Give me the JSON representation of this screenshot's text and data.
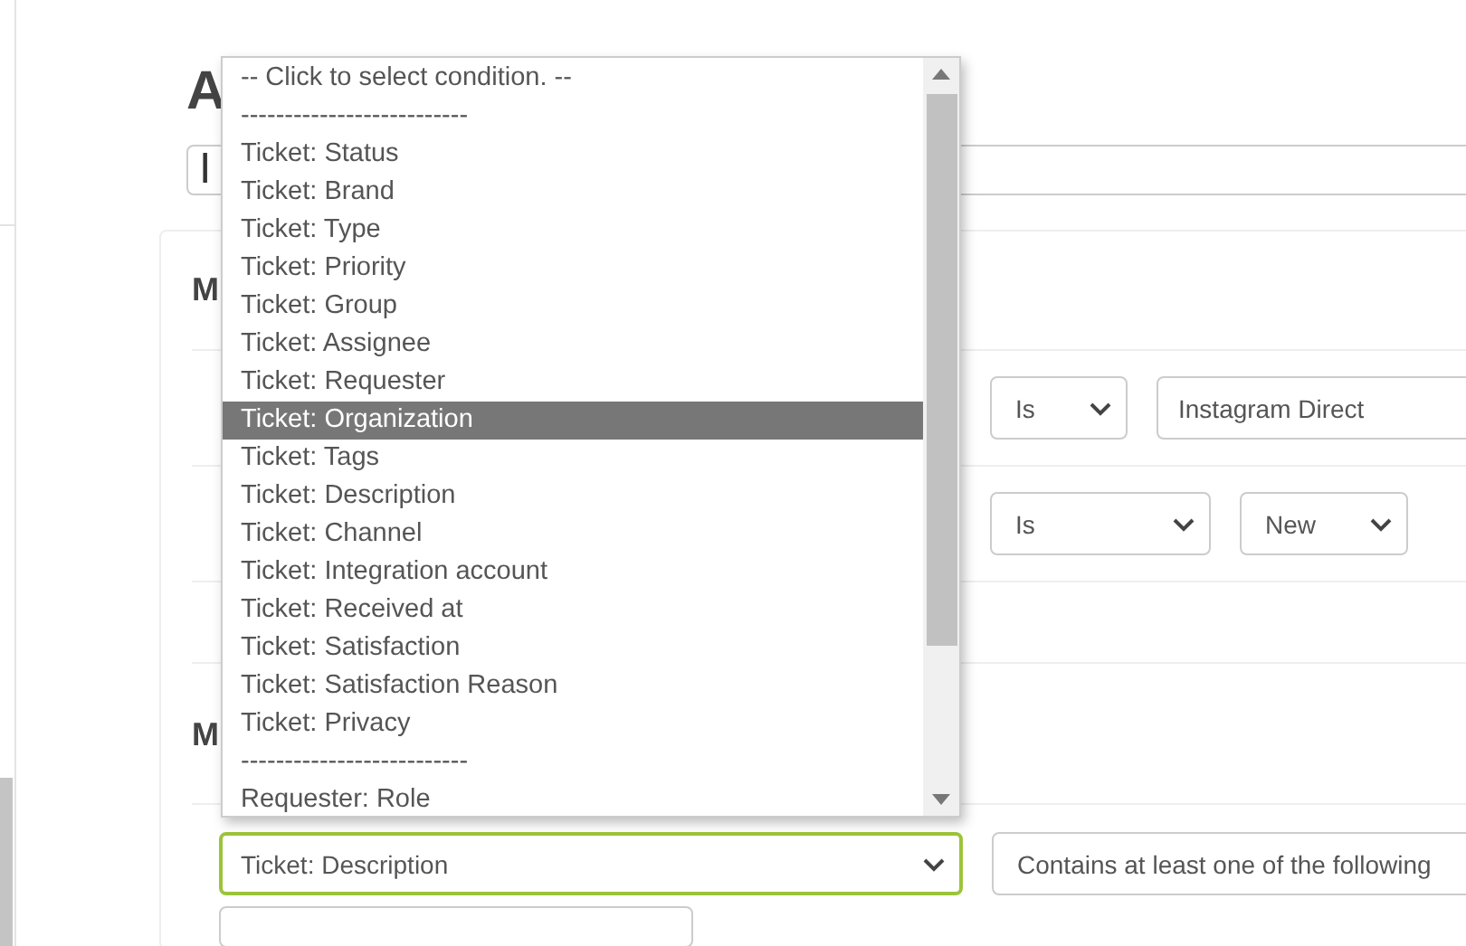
{
  "page": {
    "heading": "A",
    "name_field": {
      "value": "I"
    }
  },
  "sections": [
    {
      "title": "M",
      "rows": [
        {
          "operator": "Is",
          "value": {
            "kind": "field",
            "text": "Instagram Direct"
          }
        },
        {
          "operator": "Is",
          "value": {
            "kind": "select",
            "text": "New"
          }
        }
      ]
    },
    {
      "title": "M",
      "condition": {
        "field": "Ticket: Description",
        "operator": "Contains at least one of the following"
      }
    }
  ],
  "dropdown": {
    "options": [
      {
        "kind": "option",
        "label": "-- Click to select condition. --",
        "selected": false
      },
      {
        "kind": "separator",
        "label": "--------------------------"
      },
      {
        "kind": "option",
        "label": "Ticket: Status",
        "selected": false
      },
      {
        "kind": "option",
        "label": "Ticket: Brand",
        "selected": false
      },
      {
        "kind": "option",
        "label": "Ticket: Type",
        "selected": false
      },
      {
        "kind": "option",
        "label": "Ticket: Priority",
        "selected": false
      },
      {
        "kind": "option",
        "label": "Ticket: Group",
        "selected": false
      },
      {
        "kind": "option",
        "label": "Ticket: Assignee",
        "selected": false
      },
      {
        "kind": "option",
        "label": "Ticket: Requester",
        "selected": false
      },
      {
        "kind": "option",
        "label": "Ticket: Organization",
        "selected": true
      },
      {
        "kind": "option",
        "label": "Ticket: Tags",
        "selected": false
      },
      {
        "kind": "option",
        "label": "Ticket: Description",
        "selected": false
      },
      {
        "kind": "option",
        "label": "Ticket: Channel",
        "selected": false
      },
      {
        "kind": "option",
        "label": "Ticket: Integration account",
        "selected": false
      },
      {
        "kind": "option",
        "label": "Ticket: Received at",
        "selected": false
      },
      {
        "kind": "option",
        "label": "Ticket: Satisfaction",
        "selected": false
      },
      {
        "kind": "option",
        "label": "Ticket: Satisfaction Reason",
        "selected": false
      },
      {
        "kind": "option",
        "label": "Ticket: Privacy",
        "selected": false
      },
      {
        "kind": "separator",
        "label": "--------------------------"
      },
      {
        "kind": "option",
        "label": "Requester: Role",
        "selected": false
      }
    ]
  }
}
